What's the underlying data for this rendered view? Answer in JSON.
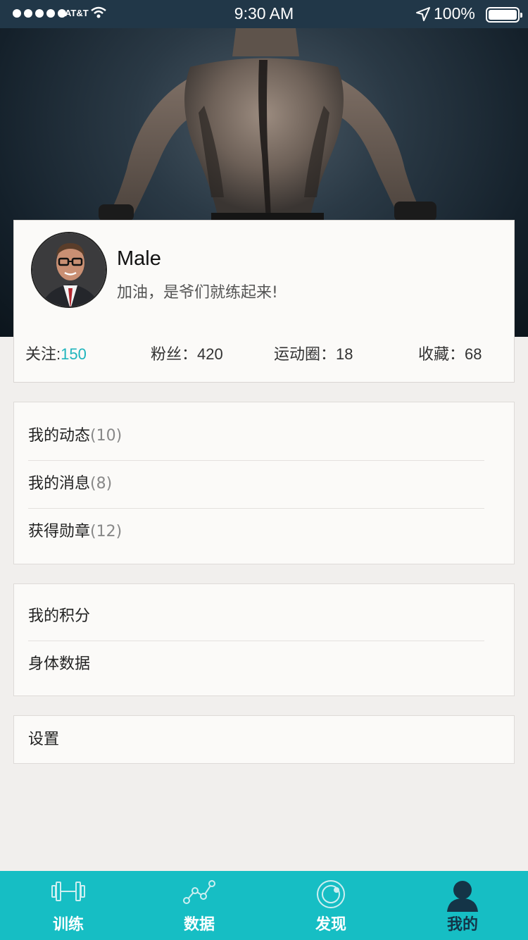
{
  "status_bar": {
    "carrier": "AT&T",
    "time": "9:30 AM",
    "battery": "100%"
  },
  "profile": {
    "name": "Male",
    "motto": "加油，是爷们就练起来!"
  },
  "stats": {
    "following_label": "关注:",
    "following_value": "150",
    "fans": "粉丝：420",
    "circles": "运动圈：18",
    "favorites": "收藏：68"
  },
  "menu1": [
    {
      "label": "我的动态",
      "count": "(10)"
    },
    {
      "label": "我的消息",
      "count": "(8)"
    },
    {
      "label": "获得勋章",
      "count": "(12)"
    }
  ],
  "menu2": [
    {
      "label": "我的积分"
    },
    {
      "label": "身体数据"
    }
  ],
  "menu3": [
    {
      "label": "设置"
    }
  ],
  "tabs": [
    {
      "label": "训练",
      "icon": "dumbbell-icon"
    },
    {
      "label": "数据",
      "icon": "chart-line-icon"
    },
    {
      "label": "发现",
      "icon": "compass-icon"
    },
    {
      "label": "我的",
      "icon": "person-icon",
      "active": true
    }
  ],
  "colors": {
    "accent": "#16bec4",
    "highlight": "#1fb5bd",
    "active_tab": "#143447"
  }
}
